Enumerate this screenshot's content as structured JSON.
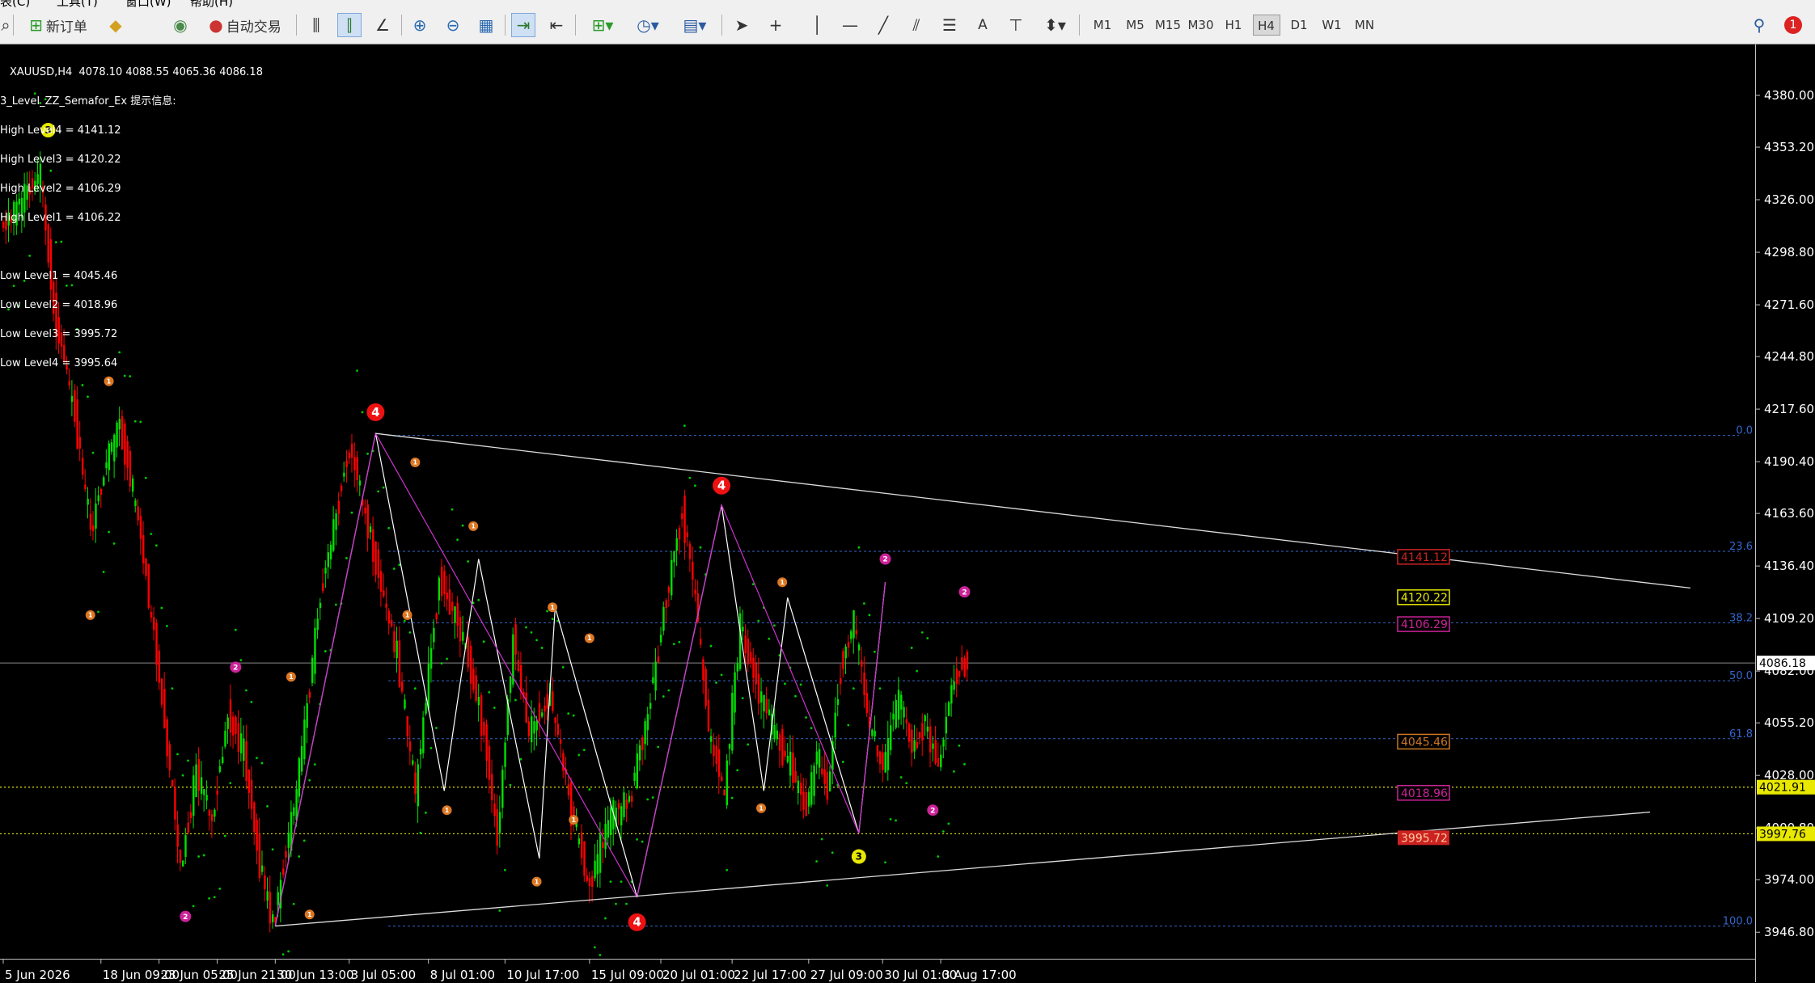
{
  "menu": [
    "表(C)",
    "工具(T)",
    "窗口(W)",
    "帮助(H)"
  ],
  "toolbar": {
    "new_order": "新订单",
    "auto_trade": "自动交易",
    "text_tool": "A",
    "timeframes": [
      "M1",
      "M5",
      "M15",
      "M30",
      "H1",
      "H4",
      "D1",
      "W1",
      "MN"
    ],
    "active_timeframe": "H4",
    "notification_count": "1"
  },
  "info": {
    "header": "XAUUSD,H4  4078.10 4088.55 4065.36 4086.18",
    "indicator": "3_Level_ZZ_Semafor_Ex 提示信息:",
    "high_levels": [
      "High Level4 = 4141.12",
      "High Level3 = 4120.22",
      "High Level2 = 4106.29",
      "High Level1 = 4106.22"
    ],
    "low_levels": [
      "Low Level1 = 4045.46",
      "Low Level2 = 4018.96",
      "Low Level3 = 3995.72",
      "Low Level4 = 3995.64"
    ]
  },
  "price_axis": [
    "4380.00",
    "4353.20",
    "4326.00",
    "4298.80",
    "4271.60",
    "4244.80",
    "4217.60",
    "4190.40",
    "4163.60",
    "4136.40",
    "4109.20",
    "4082.00",
    "4055.20",
    "4028.00",
    "4000.80",
    "3974.00",
    "3946.80"
  ],
  "time_axis": [
    "5 Jun 2026",
    "18 Jun 09:00",
    "23 Jun 05:00",
    "25 Jun 21:00",
    "30 Jun 13:00",
    "3 Jul 05:00",
    "8 Jul 01:00",
    "10 Jul 17:00",
    "15 Jul 09:00",
    "20 Jul 01:00",
    "22 Jul 17:00",
    "27 Jul 09:00",
    "30 Jul 01:00",
    "3 Aug 17:00"
  ],
  "fib_levels": [
    {
      "label": "0.0",
      "price": 4204.0
    },
    {
      "label": "23.6",
      "price": 4144.0
    },
    {
      "label": "38.2",
      "price": 4107.0
    },
    {
      "label": "50.0",
      "price": 4077.0
    },
    {
      "label": "61.8",
      "price": 4047.0
    },
    {
      "label": "100.0",
      "price": 3950.0
    }
  ],
  "price_tags": [
    {
      "label": "4141.12",
      "price": 4141.12,
      "color": "#cc2222",
      "style": "box"
    },
    {
      "label": "4120.22",
      "price": 4120.22,
      "color": "#e8e800",
      "style": "box"
    },
    {
      "label": "4106.29",
      "price": 4106.29,
      "color": "#cc2299",
      "style": "box"
    },
    {
      "label": "4045.46",
      "price": 4045.46,
      "color": "#cc7722",
      "style": "box"
    },
    {
      "label": "4018.96",
      "price": 4018.96,
      "color": "#cc2299",
      "style": "box"
    },
    {
      "label": "3995.72",
      "price": 3995.72,
      "color": "#cc2222",
      "style": "fill"
    }
  ],
  "axis_tags": [
    {
      "label": "4086.18",
      "price": 4086.18,
      "bg": "#ffffff",
      "fg": "#000000"
    },
    {
      "label": "4021.91",
      "price": 4021.91,
      "bg": "#e8e800",
      "fg": "#000000"
    },
    {
      "label": "3997.76",
      "price": 3997.76,
      "bg": "#e8e800",
      "fg": "#000000"
    }
  ],
  "colors": {
    "bull": "#00e000",
    "bear": "#ff0000",
    "sar": "#00cc00",
    "zigzag_white": "#ffffff",
    "zigzag_magenta": "#cc33cc",
    "fib": "#3366cc",
    "axis_text": "#ffffff"
  }
}
